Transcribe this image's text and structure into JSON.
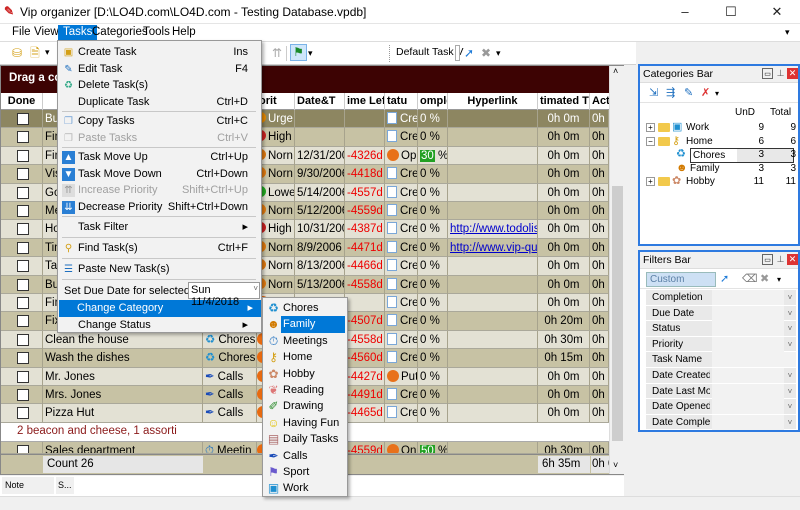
{
  "window": {
    "title": "Vip organizer [D:\\LO4D.com\\LO4D.com - Testing Database.vpdb]",
    "minimize": "–",
    "maximize": "☐",
    "close": "✕"
  },
  "menubar": [
    "File",
    "View",
    "Tasks",
    "Categories",
    "Tools",
    "Help"
  ],
  "toolbar": {
    "view_select": "Default Task V",
    "dropdown_arrow": "▾"
  },
  "grid": {
    "group_hint": "Drag a col",
    "columns": [
      "Done",
      "",
      "",
      "orit",
      "Date&T",
      "ime Lef",
      "tatu",
      "omplet",
      "Hyperlink",
      "timated Ti",
      "Actual"
    ],
    "rows": [
      {
        "name": "Bu",
        "category": "",
        "priority": "Urge",
        "date": "",
        "left": "",
        "status": "Cre",
        "complete": "0 %",
        "link": "",
        "est": "0h 0m",
        "actual": "0h 0m"
      },
      {
        "name": "Fin",
        "category": "",
        "priority": "High",
        "date": "",
        "left": "",
        "status": "Cre",
        "complete": "0 %",
        "link": "",
        "est": "0h 0m",
        "actual": "0h 0m"
      },
      {
        "name": "Fin",
        "category": "",
        "priority": "Norn",
        "date": "12/31/2006",
        "left": "-4326d",
        "status": "Op",
        "complete": "30 %",
        "link": "",
        "est": "0h 0m",
        "actual": "0h 0m"
      },
      {
        "name": "Vis",
        "category": "",
        "priority": "Norn",
        "date": "9/30/2006",
        "left": "-4418d",
        "status": "Cre",
        "complete": "0 %",
        "link": "",
        "est": "0h 0m",
        "actual": "0h 0m"
      },
      {
        "name": "Go",
        "category": "",
        "priority": "Lowe",
        "date": "5/14/2006",
        "left": "-4557d",
        "status": "Cre",
        "complete": "0 %",
        "link": "",
        "est": "0h 0m",
        "actual": "0h 0m"
      },
      {
        "name": "Me",
        "category": "",
        "priority": "Norn",
        "date": "5/12/2006",
        "left": "-4559d",
        "status": "Cre",
        "complete": "0 %",
        "link": "",
        "est": "0h 0m",
        "actual": "0h 0m"
      },
      {
        "name": "Ho",
        "category": "",
        "priority": "High",
        "date": "10/31/2006",
        "left": "-4387d",
        "status": "Cre",
        "complete": "0 %",
        "link": "http://www.todolists",
        "est": "0h 0m",
        "actual": "0h 0m"
      },
      {
        "name": "Tin",
        "category": "",
        "priority": "Norn",
        "date": "8/9/2006",
        "left": "-4471d",
        "status": "Cre",
        "complete": "0 %",
        "link": "http://www.vip-qualit",
        "est": "0h 0m",
        "actual": "0h 0m"
      },
      {
        "name": "Ta",
        "category": "",
        "priority": "Norn",
        "date": "8/13/2006",
        "left": "-4466d",
        "status": "Cre",
        "complete": "0 %",
        "link": "",
        "est": "0h 0m",
        "actual": "0h 0m"
      },
      {
        "name": "Bu",
        "category": "",
        "priority": "Norn",
        "date": "5/13/2006",
        "left": "-4558d",
        "status": "Cre",
        "complete": "0 %",
        "link": "",
        "est": "0h 0m",
        "actual": "0h 0m"
      },
      {
        "name": "Fin",
        "category": "",
        "priority": "",
        "date": "",
        "left": "",
        "status": "Cre",
        "complete": "0 %",
        "link": "",
        "est": "0h 0m",
        "actual": "0h 0m"
      },
      {
        "name": "Fix",
        "category": "",
        "priority": "",
        "date": "",
        "left": "-4507d",
        "status": "Cre",
        "complete": "0 %",
        "link": "",
        "est": "0h 20m",
        "actual": "0h 0m"
      },
      {
        "name": "Clean the house",
        "category": "Chores",
        "priority": "",
        "date": "",
        "left": "-4558d",
        "status": "Cre",
        "complete": "0 %",
        "link": "",
        "est": "0h 30m",
        "actual": "0h 0m"
      },
      {
        "name": "Wash the dishes",
        "category": "Chores",
        "priority": "",
        "date": "",
        "left": "-4560d",
        "status": "Cre",
        "complete": "0 %",
        "link": "",
        "est": "0h 15m",
        "actual": "0h 0m"
      },
      {
        "name": "Mr. Jones",
        "category": "Calls",
        "priority": "",
        "date": "",
        "left": "-4427d",
        "status": "Put",
        "complete": "0 %",
        "link": "",
        "est": "0h 0m",
        "actual": "0h 0m"
      },
      {
        "name": "Mrs. Jones",
        "category": "Calls",
        "priority": "",
        "date": "",
        "left": "-4491d",
        "status": "Cre",
        "complete": "0 %",
        "link": "",
        "est": "0h 0m",
        "actual": "0h 0m"
      },
      {
        "name": "Pizza Hut",
        "category": "Calls",
        "priority": "",
        "date": "",
        "left": "-4465d",
        "status": "Cre",
        "complete": "0 %",
        "link": "",
        "est": "0h 0m",
        "actual": "0h 0m"
      }
    ],
    "note_line": "2 beacon and cheese, 1 assorti",
    "last_row": {
      "name": "Sales department",
      "category": "Meetin",
      "left": "-4559d",
      "status": "On",
      "complete": "50 %",
      "est": "0h 30m",
      "actual": "0h 0m"
    },
    "footer": {
      "count": "Count 26",
      "est_total": "6h 35m",
      "actual_total": "0h 0m"
    },
    "scroll_up": "˄",
    "scroll_down": "˅"
  },
  "notebar": {
    "note_tab": "Note",
    "s_tab": "S..."
  },
  "tasks_menu": {
    "items": [
      {
        "label": "Create Task",
        "shortcut": "Ins",
        "icon": "create-task-icon"
      },
      {
        "label": "Edit Task",
        "shortcut": "F4",
        "icon": "edit-task-icon"
      },
      {
        "label": "Delete Task(s)",
        "shortcut": "",
        "icon": "delete-task-icon"
      },
      {
        "label": "Duplicate Task",
        "shortcut": "Ctrl+D"
      },
      {
        "label": "Copy Tasks",
        "shortcut": "Ctrl+C"
      },
      {
        "label": "Paste Tasks",
        "shortcut": "Ctrl+V"
      },
      {
        "label": "Task Move Up",
        "shortcut": "Ctrl+Up"
      },
      {
        "label": "Task Move Down",
        "shortcut": "Ctrl+Down"
      },
      {
        "label": "Increase Priority",
        "shortcut": "Shift+Ctrl+Up"
      },
      {
        "label": "Decrease Priority",
        "shortcut": "Shift+Ctrl+Down"
      },
      {
        "label": "Task Filter",
        "shortcut": "▸"
      },
      {
        "label": "Find Task(s)",
        "shortcut": "Ctrl+F"
      },
      {
        "label": "Paste New Task(s)",
        "shortcut": ""
      },
      {
        "label": "Change Category",
        "shortcut": "▸"
      },
      {
        "label": "Change Status",
        "shortcut": "▸"
      }
    ],
    "due_date_label": "Set Due Date for selected tasks",
    "due_date_value": "Sun 11/4/2018"
  },
  "category_submenu": [
    "Chores",
    "Family",
    "Meetings",
    "Home",
    "Hobby",
    "Reading",
    "Drawing",
    "Having Fun",
    "Daily Tasks",
    "Calls",
    "Sport",
    "Work"
  ],
  "categories_bar": {
    "title": "Categories Bar",
    "col_und": "UnD",
    "col_total": "Total",
    "items": [
      {
        "name": "Work",
        "und": "9",
        "total": "9",
        "expander": "+"
      },
      {
        "name": "Home",
        "und": "6",
        "total": "6",
        "expander": "−"
      },
      {
        "name": "Chores",
        "und": "3",
        "total": "3",
        "expander": ""
      },
      {
        "name": "Family",
        "und": "3",
        "total": "3",
        "expander": ""
      },
      {
        "name": "Hobby",
        "und": "11",
        "total": "11",
        "expander": "+"
      }
    ]
  },
  "filters_bar": {
    "title": "Filters Bar",
    "preset": "Custom",
    "filters": [
      "Completion",
      "Due Date",
      "Status",
      "Priority",
      "Task Name",
      "Date Created",
      "Date Last Modifi",
      "Date Opened",
      "Date Completed"
    ]
  }
}
